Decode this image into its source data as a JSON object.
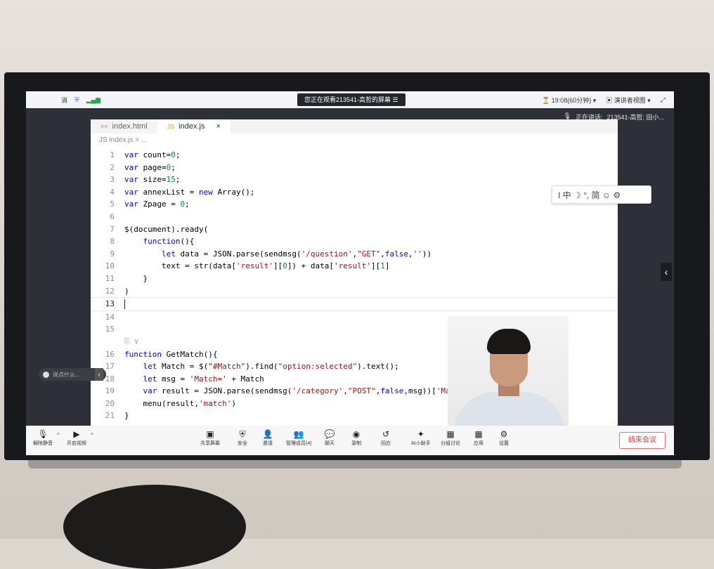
{
  "meeting": {
    "left_label": "消",
    "status_banner": "您正在观看213541-高哲的屏幕",
    "banner_icon": "☰",
    "timer": "19:08(60分钟)",
    "view_mode": "演讲者视图",
    "speaking_label": "正在讲话:",
    "speaking_name": "213541-高哲; 田小..."
  },
  "editor": {
    "tabs": [
      {
        "icon": "<>",
        "label": "index.html"
      },
      {
        "icon": "JS",
        "label": "index.js",
        "close": "×"
      }
    ],
    "breadcrumb": "JS  index.js > ...",
    "codelens": "⎘ ∨",
    "ime_toolbar": "I 中 ☽ °, 简 ☺ ⚙"
  },
  "code_lines": [
    {
      "n": "1",
      "t": "var count=0;"
    },
    {
      "n": "2",
      "t": "var page=0;"
    },
    {
      "n": "3",
      "t": "var size=15;"
    },
    {
      "n": "4",
      "t": "var annexList = new Array();"
    },
    {
      "n": "5",
      "t": "var Zpage = 0;"
    },
    {
      "n": "6",
      "t": ""
    },
    {
      "n": "7",
      "t": "$(document).ready("
    },
    {
      "n": "8",
      "t": "    function(){"
    },
    {
      "n": "9",
      "t": "        let data = JSON.parse(sendmsg('/question',\"GET\",false,''))"
    },
    {
      "n": "10",
      "t": "        text = str(data['result'][0]) + data['result'][1]"
    },
    {
      "n": "11",
      "t": "    }"
    },
    {
      "n": "12",
      "t": ")"
    },
    {
      "n": "13",
      "t": ""
    },
    {
      "n": "14",
      "t": ""
    },
    {
      "n": "15",
      "t": ""
    },
    {
      "n": "16",
      "t": "function GetMatch(){"
    },
    {
      "n": "17",
      "t": "    let Match = $(\"#Match\").find(\"option:selected\").text();"
    },
    {
      "n": "18",
      "t": "    let msg = 'Match=' + Match"
    },
    {
      "n": "19",
      "t": "    var result = JSON.parse(sendmsg('/category',\"POST\",false,msg))['Match']"
    },
    {
      "n": "20",
      "t": "    menu(result,'match')"
    },
    {
      "n": "21",
      "t": "}"
    }
  ],
  "comment": {
    "placeholder": "说点什么..."
  },
  "toolbar": {
    "left": [
      {
        "icon": "mic-icon",
        "glyph": "🎙",
        "label": "解除静音"
      },
      {
        "icon": "camera-icon",
        "glyph": "▶",
        "label": "开启视频"
      }
    ],
    "center": [
      {
        "icon": "screen-share-icon",
        "glyph": "▣",
        "label": "共享屏幕"
      },
      {
        "icon": "shield-icon",
        "glyph": "⛨",
        "label": "安全"
      },
      {
        "icon": "invite-icon",
        "glyph": "👤",
        "label": "邀请"
      },
      {
        "icon": "members-icon",
        "glyph": "👥",
        "label": "管理成员(4)"
      },
      {
        "icon": "chat-icon",
        "glyph": "💬",
        "label": "聊天"
      },
      {
        "icon": "record-icon",
        "glyph": "◉",
        "label": "录制"
      },
      {
        "icon": "replay-icon",
        "glyph": "↺",
        "label": "回应"
      },
      {
        "icon": "ai-icon",
        "glyph": "✦",
        "label": "AI小助手"
      },
      {
        "icon": "breakout-icon",
        "glyph": "▦",
        "label": "分组讨论"
      },
      {
        "icon": "apps-icon",
        "glyph": "▦",
        "label": "应用"
      },
      {
        "icon": "settings-icon",
        "glyph": "⚙",
        "label": "设置"
      }
    ],
    "end_label": "结束会议"
  },
  "colors": {
    "end_button": "#e53935",
    "editor_bg": "#ffffff",
    "keyword": "#0000ff"
  }
}
